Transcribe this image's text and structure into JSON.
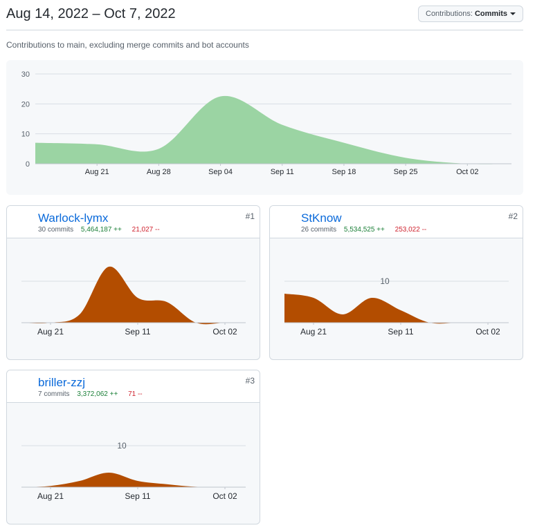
{
  "header": {
    "range_title": "Aug 14, 2022 – Oct 7, 2022",
    "contrib_prefix": "Contributions:",
    "contrib_value": "Commits"
  },
  "subtitle": "Contributions to main, excluding merge commits and bot accounts",
  "colors": {
    "main_area": "#9bd4a3",
    "contributor_area": "#b34d00",
    "grid": "#d8dee4",
    "axis_text": "#57606a",
    "link": "#0969da",
    "additions": "#1a7f37",
    "deletions": "#cf222e"
  },
  "chart_data": [
    {
      "type": "area",
      "x": [
        "2022-08-14",
        "2022-08-21",
        "2022-08-28",
        "2022-09-04",
        "2022-09-11",
        "2022-09-18",
        "2022-09-25",
        "2022-10-02",
        "2022-10-07"
      ],
      "x_tick_labels": [
        "Aug 21",
        "Aug 28",
        "Sep 04",
        "Sep 11",
        "Sep 18",
        "Sep 25",
        "Oct 02"
      ],
      "y_ticks": [
        "0",
        "10",
        "20",
        "30"
      ],
      "ylim": [
        0,
        30
      ],
      "values": [
        7,
        6.5,
        5,
        22.5,
        13,
        7,
        2,
        0,
        0
      ],
      "grid": true
    },
    {
      "type": "area",
      "x": [
        "2022-08-14",
        "2022-08-21",
        "2022-08-28",
        "2022-09-04",
        "2022-09-11",
        "2022-09-18",
        "2022-09-25",
        "2022-10-02",
        "2022-10-07"
      ],
      "x_tick_labels": [
        "Aug 21",
        "Sep 11",
        "Oct 02"
      ],
      "values": [
        0,
        0,
        2,
        13.5,
        6,
        5,
        0,
        0,
        0
      ],
      "ylim": [
        0,
        10
      ],
      "grid": true
    },
    {
      "type": "area",
      "x": [
        "2022-08-14",
        "2022-08-21",
        "2022-08-28",
        "2022-09-04",
        "2022-09-11",
        "2022-09-18",
        "2022-09-25",
        "2022-10-02",
        "2022-10-07"
      ],
      "x_tick_labels": [
        "Aug 21",
        "Sep 11",
        "Oct 02"
      ],
      "y_ticks": [
        "10"
      ],
      "values": [
        7,
        6,
        2,
        6,
        3,
        0,
        0,
        0,
        0
      ],
      "ylim": [
        0,
        10
      ],
      "grid": true
    },
    {
      "type": "area",
      "x": [
        "2022-08-14",
        "2022-08-21",
        "2022-08-28",
        "2022-09-04",
        "2022-09-11",
        "2022-09-18",
        "2022-09-25",
        "2022-10-02",
        "2022-10-07"
      ],
      "x_tick_labels": [
        "Aug 21",
        "Sep 11",
        "Oct 02"
      ],
      "y_ticks": [
        "10"
      ],
      "values": [
        0,
        0.3,
        1.5,
        3.5,
        1.5,
        0.7,
        0.1,
        0,
        0
      ],
      "ylim": [
        0,
        10
      ],
      "grid": true
    }
  ],
  "contributors": [
    {
      "rank": "#1",
      "name": "Warlock-lymx",
      "commits": "30 commits",
      "additions": "5,464,187 ++",
      "deletions": "21,027 --"
    },
    {
      "rank": "#2",
      "name": "StKnow",
      "commits": "26 commits",
      "additions": "5,534,525 ++",
      "deletions": "253,022 --"
    },
    {
      "rank": "#3",
      "name": "briller-zzj",
      "commits": "7 commits",
      "additions": "3,372,062 ++",
      "deletions": "71 --"
    }
  ]
}
